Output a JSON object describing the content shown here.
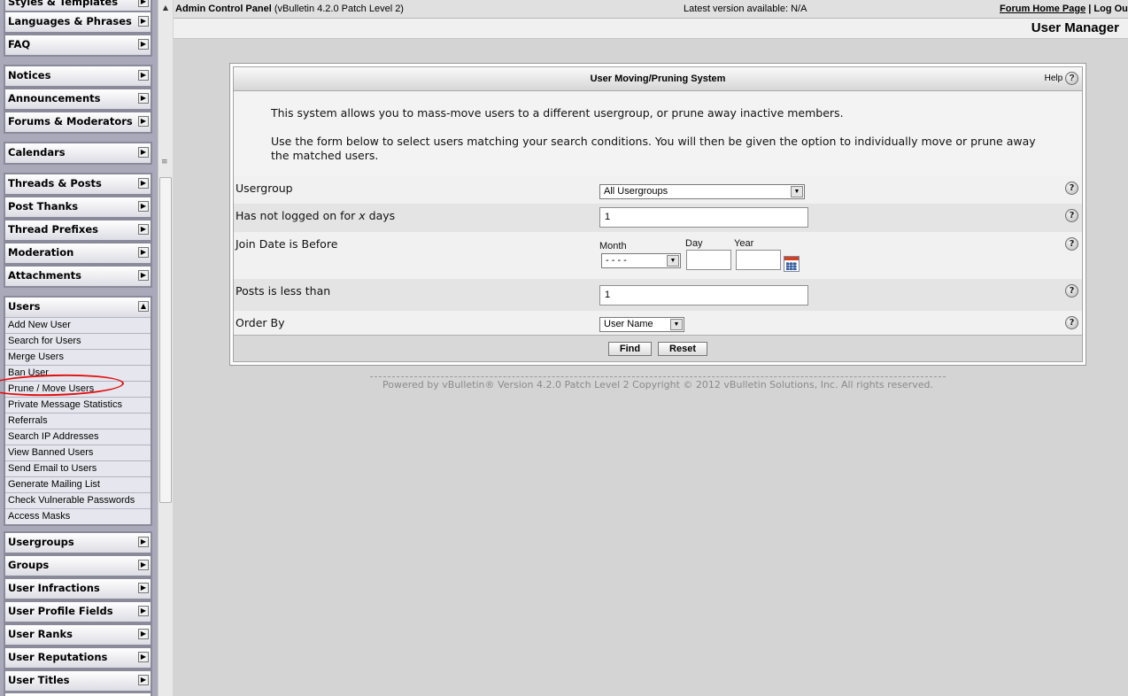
{
  "nav": {
    "top_partial": "Styles & Templates",
    "groups": [
      {
        "label": "Languages & Phrases",
        "arrow": "▶"
      },
      {
        "label": "FAQ",
        "arrow": "▶"
      },
      {
        "label": "Notices",
        "arrow": "▶"
      },
      {
        "label": "Announcements",
        "arrow": "▶"
      },
      {
        "label": "Forums & Moderators",
        "arrow": "▶"
      },
      {
        "label": "Calendars",
        "arrow": "▶"
      },
      {
        "label": "Threads & Posts",
        "arrow": "▶"
      },
      {
        "label": "Post Thanks",
        "arrow": "▶"
      },
      {
        "label": "Thread Prefixes",
        "arrow": "▶"
      },
      {
        "label": "Moderation",
        "arrow": "▶"
      },
      {
        "label": "Attachments",
        "arrow": "▶"
      },
      {
        "label": "Users",
        "arrow": "▲"
      },
      {
        "label": "Usergroups",
        "arrow": "▶"
      },
      {
        "label": "Groups",
        "arrow": "▶"
      },
      {
        "label": "User Infractions",
        "arrow": "▶"
      },
      {
        "label": "User Profile Fields",
        "arrow": "▶"
      },
      {
        "label": "User Ranks",
        "arrow": "▶"
      },
      {
        "label": "User Reputations",
        "arrow": "▶"
      },
      {
        "label": "User Titles",
        "arrow": "▶"
      }
    ],
    "users_links": [
      "Add New User",
      "Search for Users",
      "Merge Users",
      "Ban User",
      "Prune / Move Users",
      "Private Message Statistics",
      "Referrals",
      "Search IP Addresses",
      "View Banned Users",
      "Send Email to Users",
      "Generate Mailing List",
      "Check Vulnerable Passwords",
      "Access Masks"
    ],
    "scroll_arrow": "▲",
    "scroll_grip": "≡"
  },
  "topbar": {
    "title_bold": "Admin Control Panel",
    "title_rest": " (vBulletin 4.2.0 Patch Level 2)",
    "version": "Latest version available: N/A",
    "forum_home": "Forum Home Page",
    "separator": " | ",
    "logout": "Log Out"
  },
  "header": {
    "page_title": "User Manager"
  },
  "form": {
    "title": "User Moving/Pruning System",
    "help_label": "Help",
    "help_glyph": "?",
    "desc1": "This system allows you to mass-move users to a different usergroup, or prune away inactive members.",
    "desc2": "Use the form below to select users matching your search conditions. You will then be given the option to individually move or prune away the matched users.",
    "usergroup_label": "Usergroup",
    "usergroup_value": "All Usergroups",
    "days_label_a": "Has not logged on for ",
    "days_label_x": "x",
    "days_label_b": " days",
    "days_value": "1",
    "join_label": "Join Date is Before",
    "month_label": "Month",
    "day_label": "Day",
    "year_label": "Year",
    "month_value": "- - - -",
    "posts_label": "Posts is less than",
    "posts_value": "1",
    "order_label": "Order By",
    "order_value": "User Name",
    "dropdown_glyph": "▼",
    "find_button": "Find",
    "reset_button": "Reset"
  },
  "copyright": "Powered by vBulletin® Version 4.2.0 Patch Level 2 Copyright © 2012 vBulletin Solutions, Inc. All rights reserved.",
  "colors": {
    "annotation_circle": "#e01010"
  }
}
